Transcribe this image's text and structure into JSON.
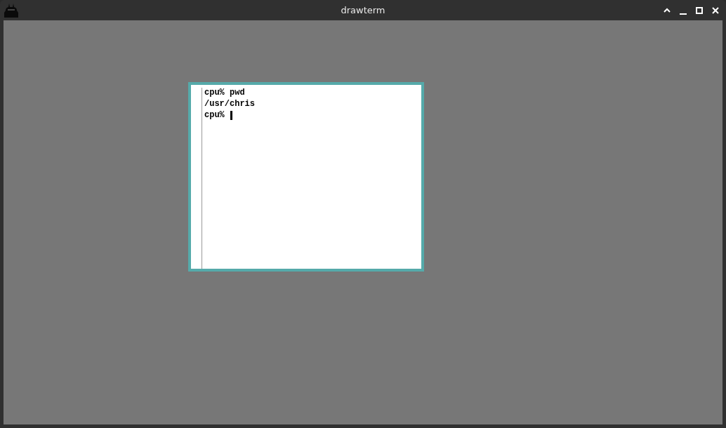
{
  "window": {
    "title": "drawterm"
  },
  "terminal": {
    "lines": [
      {
        "text": "cpu% pwd",
        "cursor": false
      },
      {
        "text": "/usr/chris",
        "cursor": false
      },
      {
        "text": "cpu% ",
        "cursor": true
      }
    ]
  }
}
